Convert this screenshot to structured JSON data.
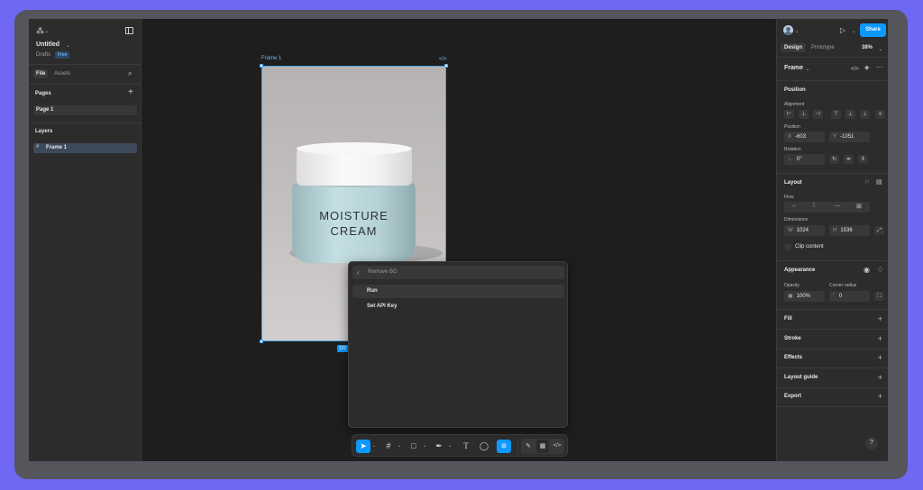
{
  "left_panel": {
    "file_name": "Untitled",
    "drafts": "Drafts",
    "plan_badge": "Free",
    "tabs": [
      "File",
      "Assets"
    ],
    "pages_heading": "Pages",
    "pages": [
      "Page 1"
    ],
    "layers_heading": "Layers",
    "layers": [
      "Frame 1"
    ]
  },
  "canvas": {
    "frame_label": "Frame 1",
    "product_text_line1": "MOISTURE",
    "product_text_line2": "CREAM",
    "dimension_badge": "102"
  },
  "plugin_menu": {
    "title": "Remove BG",
    "items": [
      "Run",
      "Set API Key"
    ]
  },
  "right_panel": {
    "share_label": "Share",
    "tabs": [
      "Design",
      "Prototype"
    ],
    "zoom": "38%",
    "selection_type": "Frame",
    "position_heading": "Position",
    "alignment_label": "Alignment",
    "position_label": "Position",
    "x_label": "X",
    "x_value": "-603",
    "y_label": "Y",
    "y_value": "-1051",
    "rotation_label": "Rotation",
    "rotation_value": "0°",
    "layout_heading": "Layout",
    "flow_label": "Flow",
    "dimensions_label": "Dimensions",
    "w_label": "W",
    "w_value": "1024",
    "h_label": "H",
    "h_value": "1536",
    "clip_content": "Clip content",
    "appearance_heading": "Appearance",
    "opacity_label": "Opacity",
    "opacity_value": "100%",
    "corner_label": "Corner radius",
    "corner_value": "0",
    "sections": [
      "Fill",
      "Stroke",
      "Effects",
      "Layout guide",
      "Export"
    ],
    "help": "?"
  },
  "colors": {
    "accent": "#0d99ff",
    "backdrop": "#6f68f2"
  }
}
